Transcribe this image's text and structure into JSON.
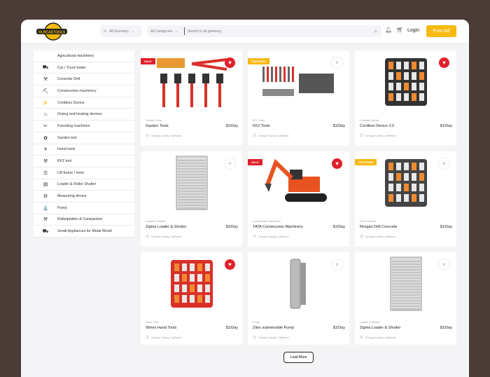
{
  "header": {
    "logo_text": "OLRCAETOOLS",
    "location": "All Germany",
    "category": "All Categories",
    "search_placeholder": "Search in all germany",
    "login": "Login",
    "post_ad": "Post Ad"
  },
  "sidebar": {
    "items": [
      {
        "label": "Agricultural machinery",
        "icon": ""
      },
      {
        "label": "Car / Truck trailer",
        "icon": "⛟"
      },
      {
        "label": "Concrete Drill",
        "icon": "⚒"
      },
      {
        "label": "Construction machinery",
        "icon": "⛏"
      },
      {
        "label": "Cordless Device",
        "icon": "⚡"
      },
      {
        "label": "Drying and heating devices",
        "icon": "♨"
      },
      {
        "label": "Foresting machines",
        "icon": "✂"
      },
      {
        "label": "Garden tool",
        "icon": "✿"
      },
      {
        "label": "Hand tools",
        "icon": "✕"
      },
      {
        "label": "KFZ tool",
        "icon": "⚒"
      },
      {
        "label": "Lift frame / hoist",
        "icon": "☰"
      },
      {
        "label": "Loader & Roller Shutter",
        "icon": "▤"
      },
      {
        "label": "Measuring device",
        "icon": "⚙"
      },
      {
        "label": "Pump",
        "icon": "⛲"
      },
      {
        "label": "Rüttelplatten & Compaction",
        "icon": "⚒"
      },
      {
        "label": "Small Appliances for Metal Wood",
        "icon": "⛟"
      }
    ]
  },
  "products": [
    {
      "category": "Garden Tools",
      "name": "Garden Tools",
      "price": "$1/Day",
      "location": "George Colony, California",
      "badge": "SALE",
      "favorite": true,
      "kind": "garden",
      "color": "#d9302a"
    },
    {
      "category": "KFZ Tools",
      "name": "KFZ Tools",
      "price": "$1/Day",
      "location": "George Colony, California",
      "badge": "FEATURED",
      "favorite": false,
      "kind": "kfz",
      "color": "#555555"
    },
    {
      "category": "Cordless Device",
      "name": "Cordless Device 2.0",
      "price": "$1/Day",
      "location": "George Colony, California",
      "badge": "",
      "favorite": true,
      "kind": "case",
      "color": "#333333"
    },
    {
      "category": "Loader & Shutter",
      "name": "Zigma Loader & Shutter",
      "price": "$1/Day",
      "location": "George Colony, California",
      "badge": "",
      "favorite": false,
      "kind": "shutter",
      "color": "#aaaaaa"
    },
    {
      "category": "Construction Machinery",
      "name": "TATA Construction Machinery",
      "price": "$1/Day",
      "location": "George Colony, California",
      "badge": "SALE",
      "favorite": true,
      "kind": "excavator",
      "color": "#e8531f"
    },
    {
      "category": "Drill Concrete",
      "name": "Morgan Drill Concrete",
      "price": "$1/Day",
      "location": "George Colony, California",
      "badge": "FEATURED",
      "favorite": false,
      "kind": "case",
      "color": "#444444"
    },
    {
      "category": "Hand Tools",
      "name": "Winex Hand Tools",
      "price": "$1/Day",
      "location": "George Colony, California",
      "badge": "",
      "favorite": true,
      "kind": "case",
      "color": "#d9302a"
    },
    {
      "category": "Pump",
      "name": "Zitex submersible Pump",
      "price": "$1/Day",
      "location": "George Colony, California",
      "badge": "",
      "favorite": false,
      "kind": "pump",
      "color": "#9a9a9a"
    },
    {
      "category": "Loader & Shutter",
      "name": "Zigma Loader & Shutter",
      "price": "$1/Day",
      "location": "George Colony, California",
      "badge": "",
      "favorite": false,
      "kind": "shutter",
      "color": "#aaaaaa"
    }
  ],
  "load_more": "Load More"
}
